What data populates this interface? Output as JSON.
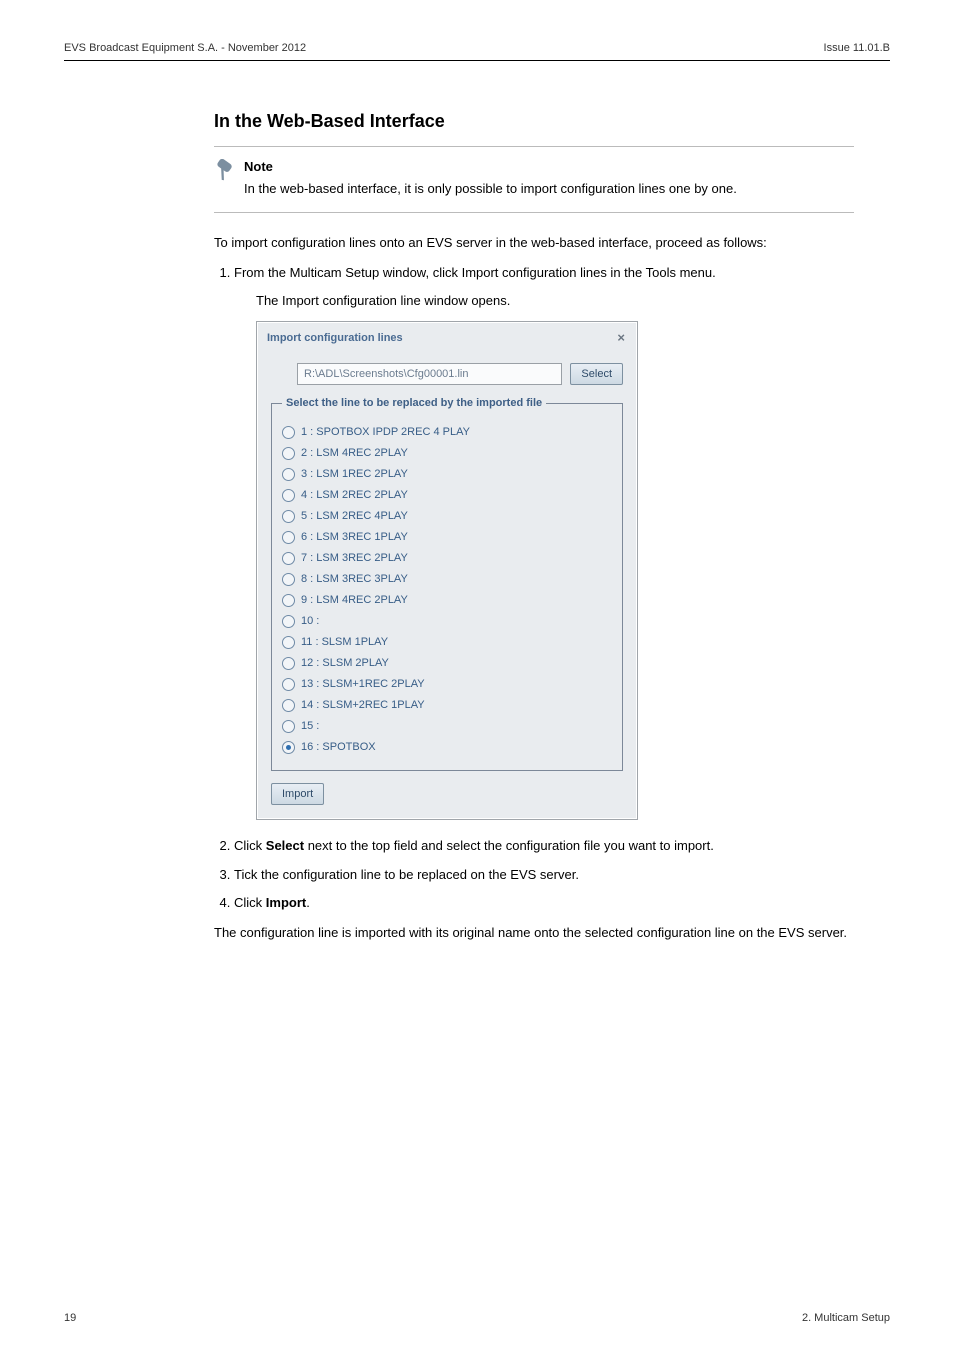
{
  "header": {
    "left": "EVS Broadcast Equipment S.A.  - November 2012",
    "right": "Issue 11.01.B"
  },
  "section_title": "In the Web-Based Interface",
  "note": {
    "title": "Note",
    "body": "In the web-based interface, it is only possible to import configuration lines one by one."
  },
  "intro": "To import configuration lines onto an EVS server in the web-based interface, proceed as follows:",
  "step1": "From the Multicam Setup window, click Import configuration lines in the Tools menu.",
  "step1_result": "The Import configuration line window opens.",
  "dialog": {
    "title": "Import configuration lines",
    "close": "×",
    "path_value": "R:\\ADL\\Screenshots\\Cfg00001.lin",
    "select_btn": "Select",
    "fieldset_legend": "Select the line to be replaced by the imported file",
    "options": [
      {
        "label": "1 : SPOTBOX IPDP 2REC 4 PLAY",
        "selected": false
      },
      {
        "label": "2 : LSM 4REC 2PLAY",
        "selected": false
      },
      {
        "label": "3 : LSM 1REC 2PLAY",
        "selected": false
      },
      {
        "label": "4 : LSM 2REC 2PLAY",
        "selected": false
      },
      {
        "label": "5 : LSM 2REC 4PLAY",
        "selected": false
      },
      {
        "label": "6 : LSM 3REC 1PLAY",
        "selected": false
      },
      {
        "label": "7 : LSM 3REC 2PLAY",
        "selected": false
      },
      {
        "label": "8 : LSM 3REC 3PLAY",
        "selected": false
      },
      {
        "label": "9 : LSM 4REC 2PLAY",
        "selected": false
      },
      {
        "label": "10 :",
        "selected": false
      },
      {
        "label": "11 : SLSM 1PLAY",
        "selected": false
      },
      {
        "label": "12 : SLSM 2PLAY",
        "selected": false
      },
      {
        "label": "13 : SLSM+1REC 2PLAY",
        "selected": false
      },
      {
        "label": "14 : SLSM+2REC 1PLAY",
        "selected": false
      },
      {
        "label": "15 :",
        "selected": false
      },
      {
        "label": "16 : SPOTBOX",
        "selected": true
      }
    ],
    "import_btn": "Import"
  },
  "step2_pre": "Click ",
  "step2_bold": "Select",
  "step2_post": " next to the top field and select the configuration file you want to import.",
  "step3": "Tick the configuration line to be replaced on the EVS server.",
  "step4_pre": "Click ",
  "step4_bold": "Import",
  "step4_post": ".",
  "outro": "The configuration line is imported with its original name onto the selected configuration line on the EVS server.",
  "footer": {
    "page": "19",
    "section": "2. Multicam Setup"
  }
}
